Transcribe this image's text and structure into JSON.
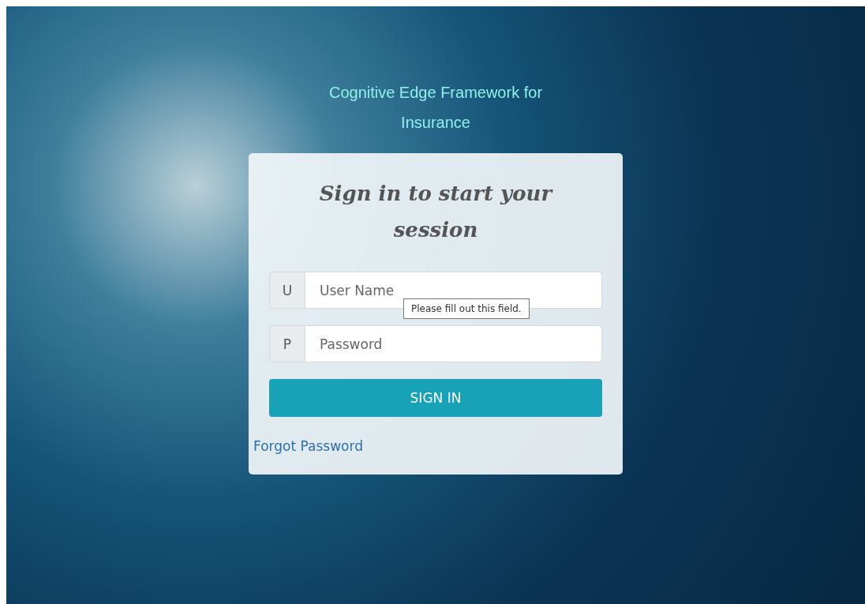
{
  "app_title": "Cognitive Edge Framework for Insurance",
  "card": {
    "heading": "Sign in to start your session",
    "fields": [
      {
        "addon": "U",
        "placeholder": "User Name",
        "tooltip": "Please fill out this field."
      },
      {
        "addon": "P",
        "placeholder": "Password"
      }
    ],
    "submit": "SIGN IN",
    "forgot_link": "Forgot Password"
  }
}
